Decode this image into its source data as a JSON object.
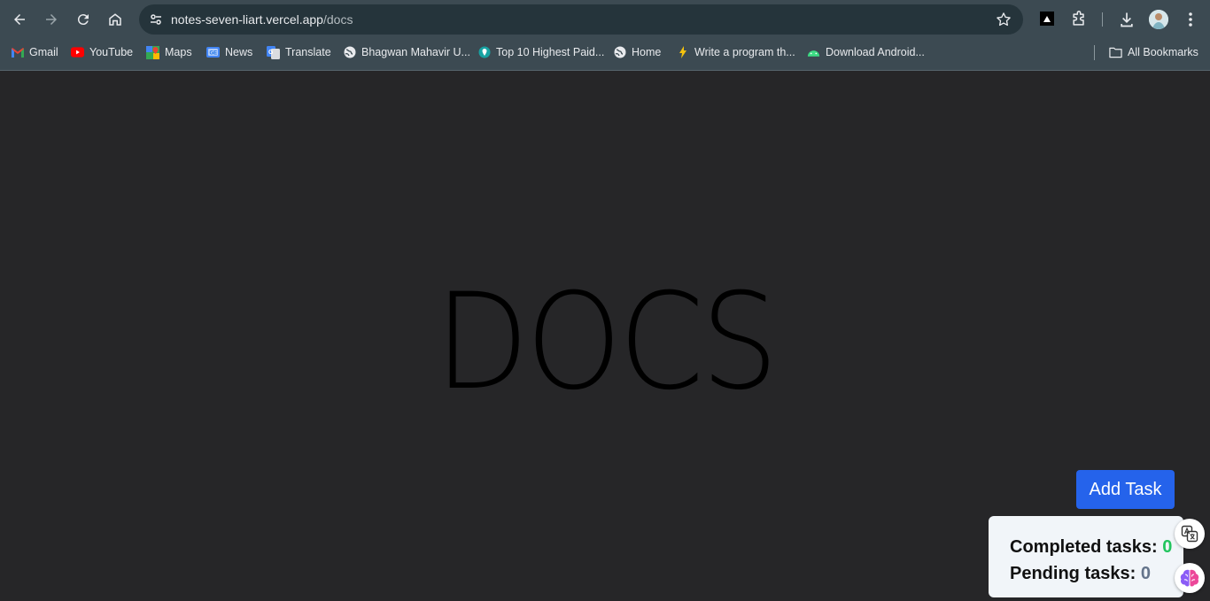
{
  "browser": {
    "url_host": "notes-seven-liart.vercel.app",
    "url_path": "/docs",
    "bookmarks": [
      {
        "label": "Gmail",
        "icon": "gmail-icon"
      },
      {
        "label": "YouTube",
        "icon": "youtube-icon"
      },
      {
        "label": "Maps",
        "icon": "maps-icon"
      },
      {
        "label": "News",
        "icon": "news-icon"
      },
      {
        "label": "Translate",
        "icon": "translate-icon"
      },
      {
        "label": "Bhagwan Mahavir U...",
        "icon": "globe-icon"
      },
      {
        "label": "Top 10 Highest Paid...",
        "icon": "location-pin-icon"
      },
      {
        "label": "Home",
        "icon": "globe-icon"
      },
      {
        "label": "Write a program th...",
        "icon": "lightning-icon"
      },
      {
        "label": "Download Android...",
        "icon": "android-icon"
      }
    ],
    "all_bookmarks": "All Bookmarks"
  },
  "page": {
    "title": "DOCS",
    "add_task_label": "Add Task",
    "completed_label": "Completed tasks:",
    "completed_count": "0",
    "pending_label": "Pending tasks:",
    "pending_count": "0"
  },
  "colors": {
    "page_background": "#262628",
    "accent_button": "#2563eb",
    "completed_count": "#22c55e"
  }
}
